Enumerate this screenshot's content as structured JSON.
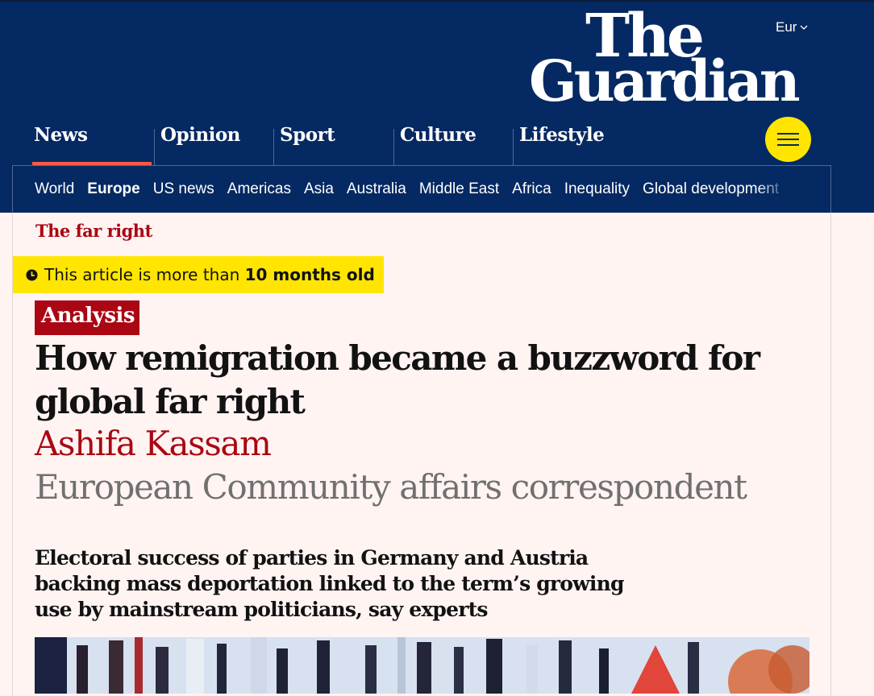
{
  "header": {
    "edition": "Eur",
    "logo": {
      "line1": "The",
      "line2": "Guardian"
    },
    "pillars": [
      {
        "label": "News",
        "active": true
      },
      {
        "label": "Opinion"
      },
      {
        "label": "Sport"
      },
      {
        "label": "Culture"
      },
      {
        "label": "Lifestyle"
      }
    ],
    "subnav": [
      "World",
      "Europe",
      "US news",
      "Americas",
      "Asia",
      "Australia",
      "Middle East",
      "Africa",
      "Inequality",
      "Global development"
    ],
    "subnav_current": "Europe"
  },
  "article": {
    "kicker": "The far right",
    "age_warning": {
      "prefix": "This article is more than ",
      "age": "10 months old"
    },
    "label": "Analysis",
    "headline": "How remigration became a buzzword for global far right",
    "author": "Ashifa Kassam",
    "author_role": "European Community affairs correspondent",
    "standfirst": "Electoral success of parties in Germany and Austria backing mass deportation linked to the term’s growing use by mainstream politicians, say experts"
  },
  "colors": {
    "brand_blue": "#052962",
    "news_red": "#ab0613",
    "highlight_yellow": "#ffe500",
    "page_bg": "#fff4f2"
  },
  "icons": {
    "edition_chevron": "chevron-down-icon",
    "menu": "hamburger-menu-icon",
    "clock": "clock-icon"
  }
}
